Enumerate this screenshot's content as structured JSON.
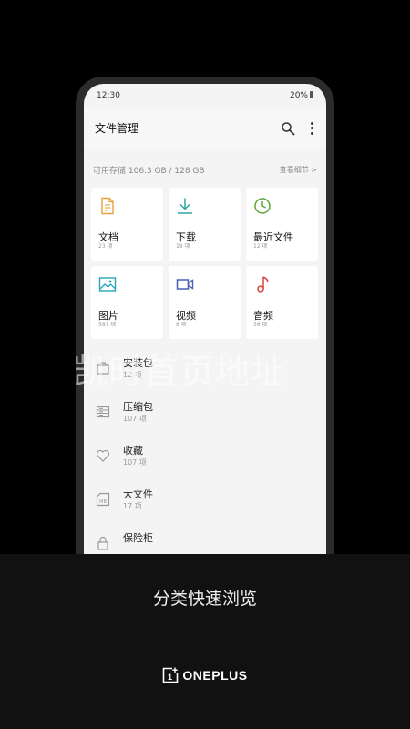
{
  "status_bar": {
    "time": "12:30",
    "battery": "20%"
  },
  "app_bar": {
    "title": "文件管理"
  },
  "storage": {
    "available": "可用存储 106.3 GB / 128 GB",
    "details_link": "查看细节 >"
  },
  "categories": [
    {
      "label": "文档",
      "count": "23 项",
      "icon": "document-icon",
      "color": "#e8a13c"
    },
    {
      "label": "下载",
      "count": "19 项",
      "icon": "download-icon",
      "color": "#2aa7a0"
    },
    {
      "label": "最近文件",
      "count": "12 项",
      "icon": "clock-icon",
      "color": "#5aa83a"
    },
    {
      "label": "图片",
      "count": "587 项",
      "icon": "image-icon",
      "color": "#25a6b8"
    },
    {
      "label": "视频",
      "count": "8 项",
      "icon": "video-icon",
      "color": "#4a5fb5"
    },
    {
      "label": "音频",
      "count": "36 项",
      "icon": "music-note-icon",
      "color": "#d8433b"
    }
  ],
  "list_items": [
    {
      "label": "安装包",
      "count": "12 项",
      "icon": "package-icon"
    },
    {
      "label": "压缩包",
      "count": "107 项",
      "icon": "archive-icon"
    },
    {
      "label": "收藏",
      "count": "107 项",
      "icon": "heart-icon"
    },
    {
      "label": "大文件",
      "count": "17 项",
      "icon": "large-file-icon"
    },
    {
      "label": "保险柜",
      "count": "",
      "icon": "lock-icon"
    }
  ],
  "watermark": "凯时首页地址",
  "caption": "分类快速浏览",
  "brand": {
    "name": "ONEPLUS"
  }
}
